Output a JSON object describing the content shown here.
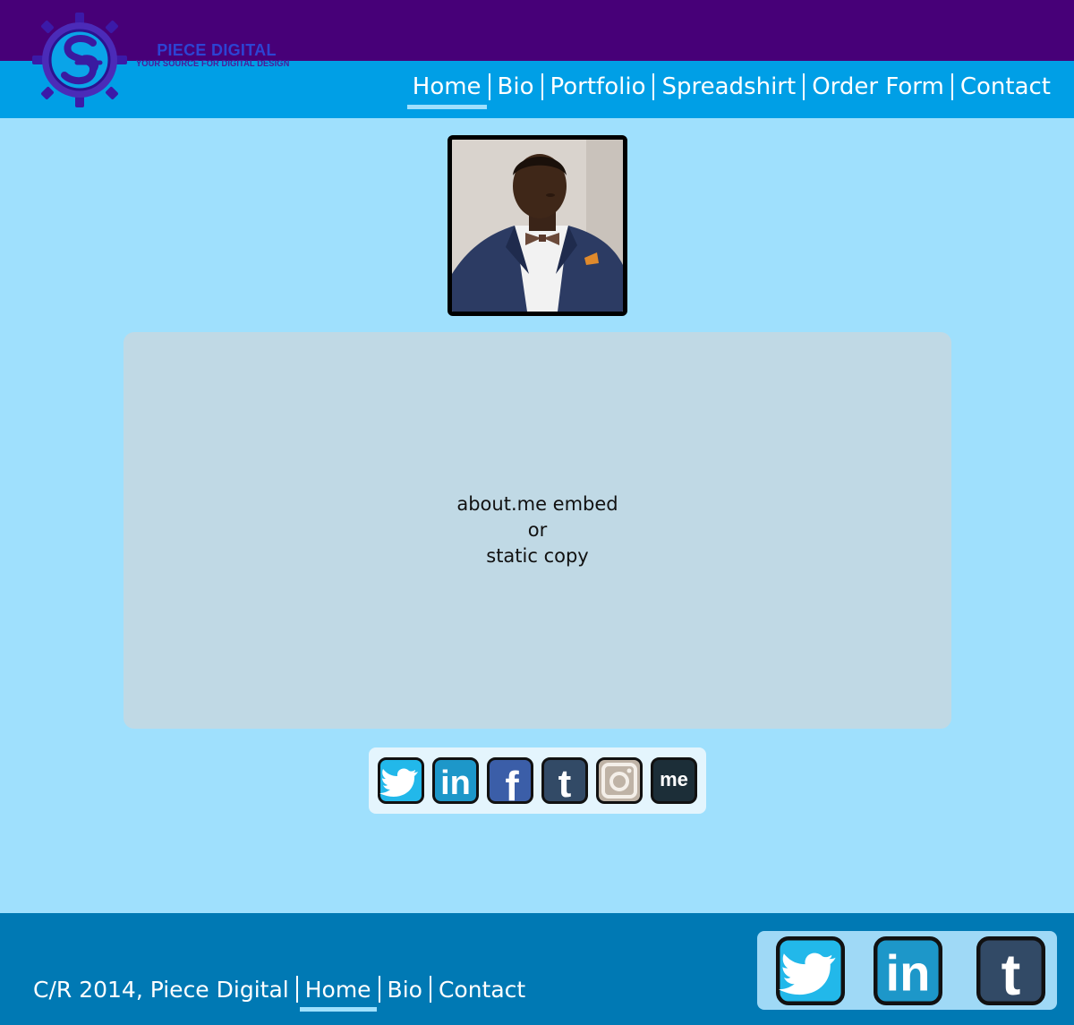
{
  "brand": {
    "name": "PIECE DIGITAL",
    "tagline": "YOUR SOURCE FOR DIGITAL DESIGN"
  },
  "nav": {
    "items": [
      {
        "label": "Home",
        "active": true
      },
      {
        "label": "Bio"
      },
      {
        "label": "Portfolio"
      },
      {
        "label": "Spreadshirt"
      },
      {
        "label": "Order Form"
      },
      {
        "label": "Contact"
      }
    ]
  },
  "embed": {
    "line1": "about.me embed",
    "line2": "or",
    "line3": "static copy"
  },
  "social": {
    "icons": [
      "twitter-icon",
      "linkedin-icon",
      "facebook-icon",
      "tumblr-icon",
      "instagram-icon",
      "aboutme-icon"
    ],
    "me_glyph": "me",
    "tumblr_glyph": "t",
    "linkedin_glyph": "in",
    "facebook_glyph": "f"
  },
  "footer": {
    "copyright": "C/R 2014, Piece Digital",
    "links": [
      {
        "label": "Home",
        "active": true
      },
      {
        "label": "Bio"
      },
      {
        "label": "Contact"
      }
    ],
    "icons": [
      "twitter-icon",
      "linkedin-icon",
      "tumblr-icon"
    ]
  },
  "colors": {
    "top_band": "#470078",
    "nav_band": "#009fe6",
    "page_bg": "#9fe0fd",
    "embed_bg": "#c0d9e5",
    "footer_bg": "#0079b4"
  }
}
